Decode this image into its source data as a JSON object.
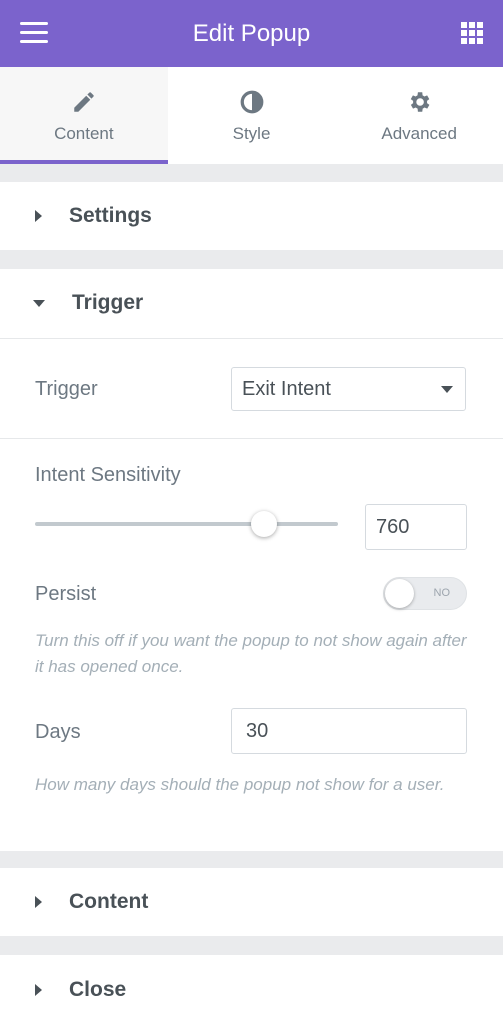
{
  "header": {
    "title": "Edit Popup",
    "menu_icon": "hamburger-icon",
    "apps_icon": "grid-icon",
    "bg_color": "#7b63cc"
  },
  "tabs": [
    {
      "label": "Content",
      "icon": "pencil-icon",
      "active": true
    },
    {
      "label": "Style",
      "icon": "contrast-icon",
      "active": false
    },
    {
      "label": "Advanced",
      "icon": "gear-icon",
      "active": false
    }
  ],
  "sections": {
    "settings": {
      "label": "Settings",
      "expanded": false
    },
    "trigger": {
      "label": "Trigger",
      "expanded": true
    },
    "content": {
      "label": "Content",
      "expanded": false
    },
    "close": {
      "label": "Close",
      "expanded": false
    }
  },
  "trigger": {
    "trigger_label": "Trigger",
    "trigger_value": "Exit Intent",
    "sensitivity_label": "Intent Sensitivity",
    "sensitivity_value": "760",
    "sensitivity_fraction": 0.76,
    "persist_label": "Persist",
    "persist_toggle": "NO",
    "persist_help": "Turn this off if you want the popup to not show again after it has opened once.",
    "days_label": "Days",
    "days_value": "30",
    "days_help": "How many days should the popup not show for a user."
  }
}
